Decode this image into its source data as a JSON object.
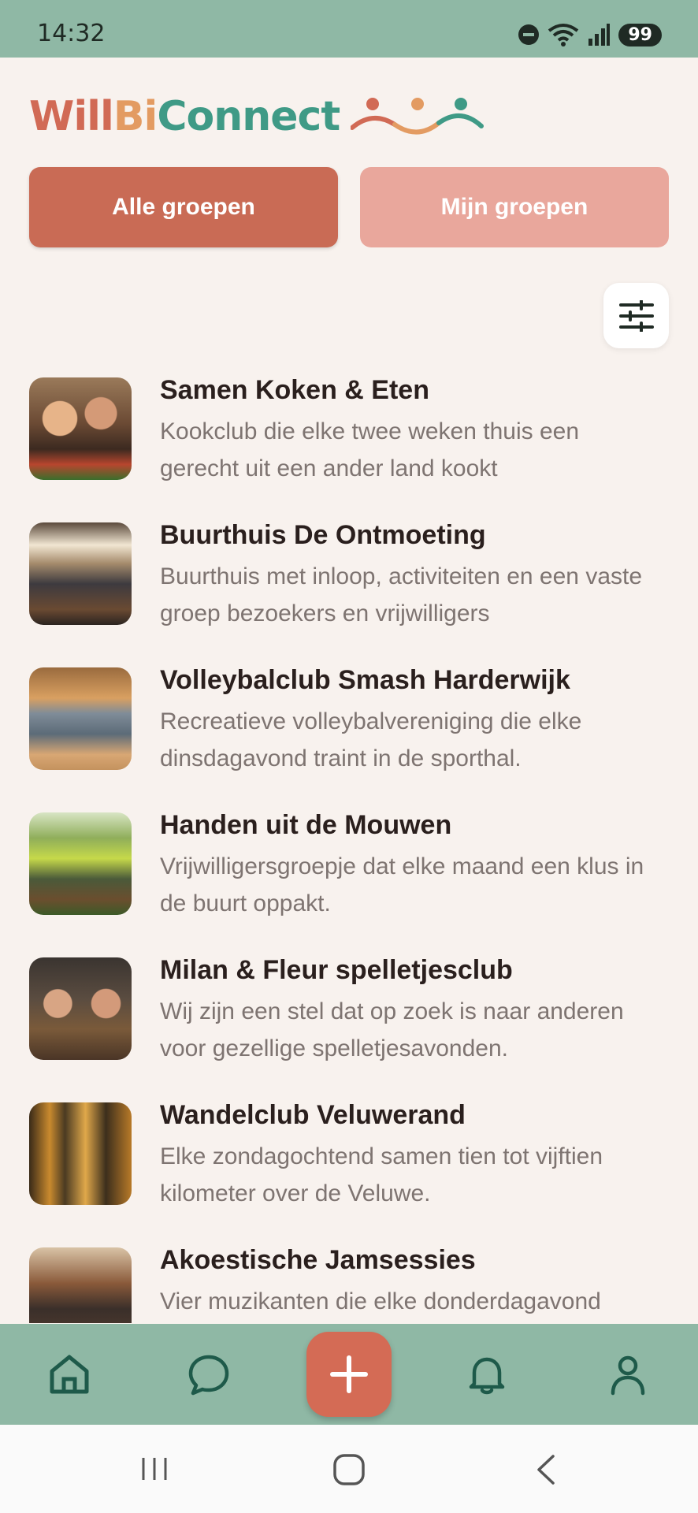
{
  "status": {
    "time": "14:32",
    "battery": "99"
  },
  "app": {
    "logo_part1": "Will",
    "logo_part2": "Bi",
    "logo_part3": "Connect"
  },
  "tabs": [
    {
      "label": "Alle groepen",
      "active": true
    },
    {
      "label": "Mijn groepen",
      "active": false
    }
  ],
  "filter_icon": "sliders-icon",
  "groups": [
    {
      "title": "Samen Koken & Eten",
      "description": "Kookclub die elke twee weken thuis een gerecht uit een ander land kookt"
    },
    {
      "title": "Buurthuis De Ontmoeting",
      "description": "Buurthuis met inloop, activiteiten en een vaste groep bezoekers en vrijwilligers"
    },
    {
      "title": "Volleybalclub Smash Harderwijk",
      "description": "Recreatieve volleybalvereniging die elke dinsdagavond traint in de sporthal."
    },
    {
      "title": "Handen uit de Mouwen",
      "description": "Vrijwilligersgroepje dat elke maand een klus in de buurt oppakt."
    },
    {
      "title": "Milan & Fleur spelletjesclub",
      "description": "Wij zijn een stel dat op zoek is naar anderen voor gezellige spelletjesavonden."
    },
    {
      "title": "Wandelclub Veluwerand",
      "description": "Elke zondagochtend samen tien tot vijftien kilometer over de Veluwe."
    },
    {
      "title": "Akoestische Jamsessies",
      "description": "Vier muzikanten die elke donderdagavond"
    }
  ],
  "nav": {
    "items": [
      "home-icon",
      "chat-icon",
      "plus-icon",
      "bell-icon",
      "profile-icon"
    ],
    "active": "home-icon"
  },
  "colors": {
    "primary": "#C96B55",
    "secondary": "#E9A79C",
    "bar": "#8FB8A5",
    "background": "#F8F2EE"
  }
}
